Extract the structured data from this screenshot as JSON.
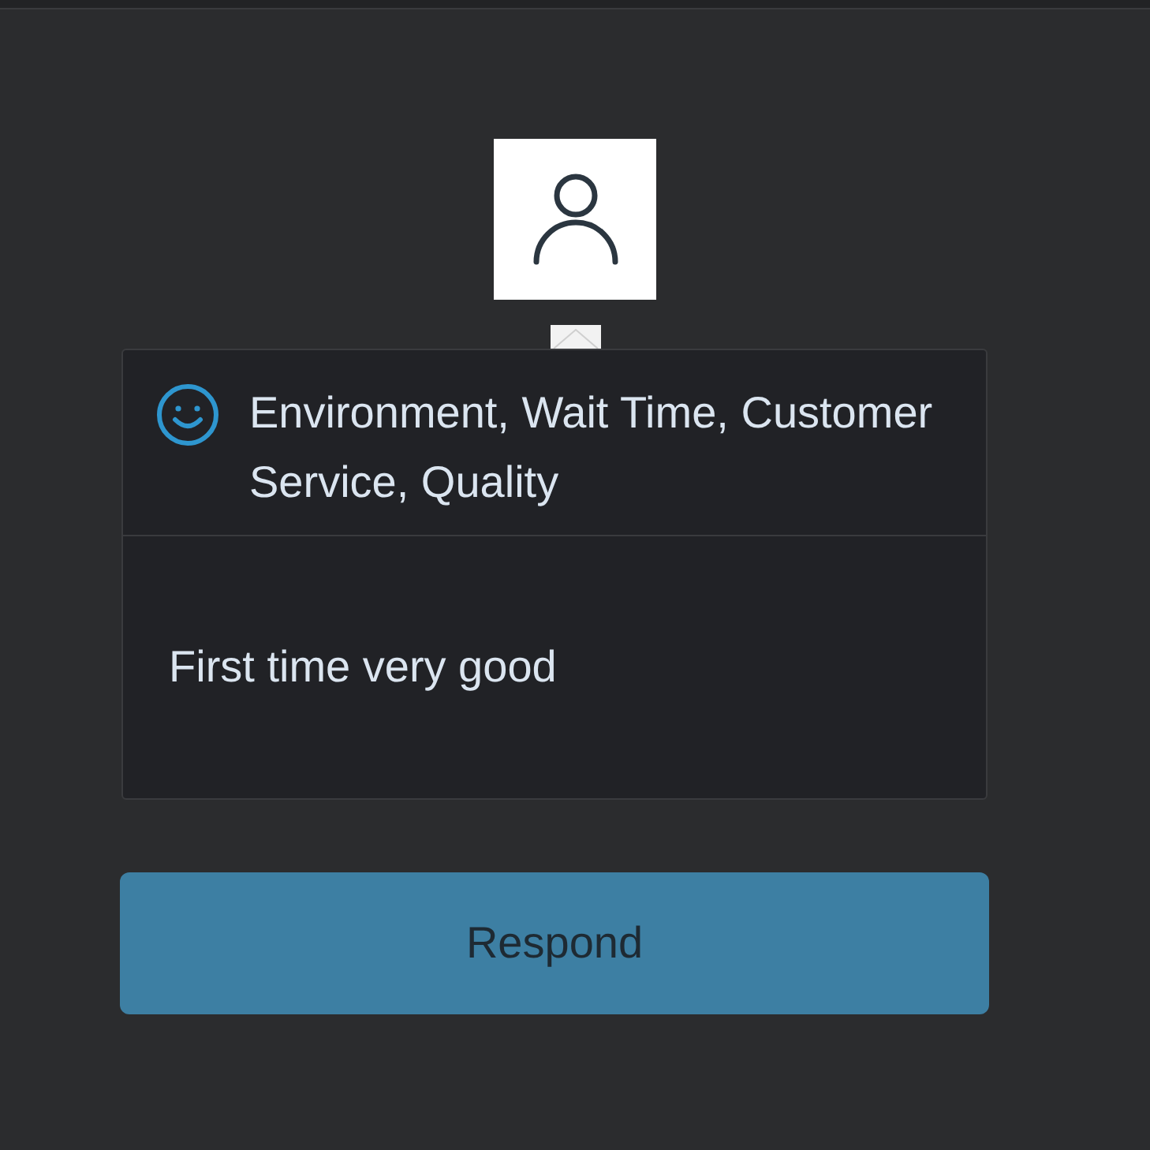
{
  "review": {
    "positive": true,
    "categories": "Environment, Wait Time, Customer Service, Quality",
    "comment": "First time very good"
  },
  "button": {
    "label": "Respond"
  }
}
